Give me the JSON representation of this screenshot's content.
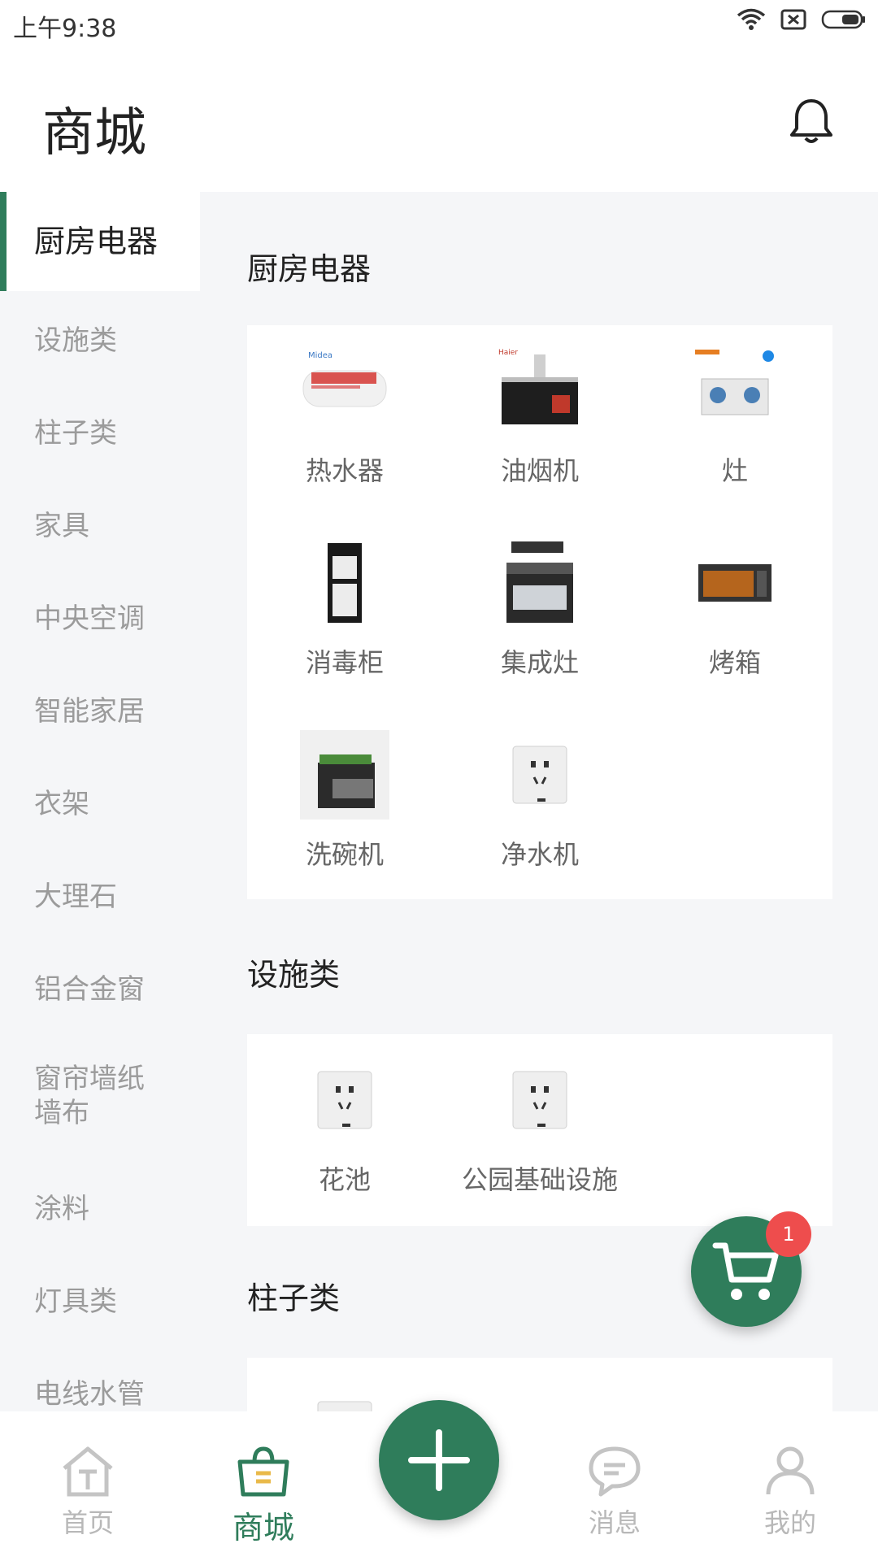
{
  "status_bar": {
    "time": "上午9:38"
  },
  "header": {
    "title": "商城"
  },
  "sidebar": {
    "items": [
      {
        "label": "厨房电器",
        "active": true
      },
      {
        "label": "设施类"
      },
      {
        "label": "柱子类"
      },
      {
        "label": "家具"
      },
      {
        "label": "中央空调"
      },
      {
        "label": "智能家居"
      },
      {
        "label": "衣架"
      },
      {
        "label": "大理石"
      },
      {
        "label": "铝合金窗"
      },
      {
        "label": "窗帘墙纸墙布"
      },
      {
        "label": "涂料"
      },
      {
        "label": "灯具类"
      },
      {
        "label": "电线水管"
      }
    ]
  },
  "sections": [
    {
      "title": "厨房电器",
      "products": [
        {
          "label": "热水器",
          "icon": "water-heater-icon"
        },
        {
          "label": "油烟机",
          "icon": "range-hood-icon"
        },
        {
          "label": "灶",
          "icon": "stove-icon"
        },
        {
          "label": "消毒柜",
          "icon": "disinfection-cabinet-icon"
        },
        {
          "label": "集成灶",
          "icon": "integrated-stove-icon"
        },
        {
          "label": "烤箱",
          "icon": "oven-icon"
        },
        {
          "label": "洗碗机",
          "icon": "dishwasher-icon"
        },
        {
          "label": "净水机",
          "icon": "outlet-icon"
        }
      ]
    },
    {
      "title": "设施类",
      "products": [
        {
          "label": "花池",
          "icon": "outlet-icon"
        },
        {
          "label": "公园基础设施",
          "icon": "outlet-icon"
        }
      ]
    },
    {
      "title": "柱子类",
      "products": []
    }
  ],
  "cart": {
    "badge_count": "1"
  },
  "bottom_nav": {
    "items": [
      {
        "label": "首页",
        "icon": "home-icon"
      },
      {
        "label": "商城",
        "icon": "shopping-bag-icon",
        "active": true
      },
      {
        "label": "消息",
        "icon": "message-icon"
      },
      {
        "label": "我的",
        "icon": "profile-icon"
      }
    ],
    "add_icon": "plus-icon"
  },
  "colors": {
    "accent": "#2f7d5b",
    "badge": "#ee4d4d",
    "sidebar_bg": "#f5f6f8"
  }
}
